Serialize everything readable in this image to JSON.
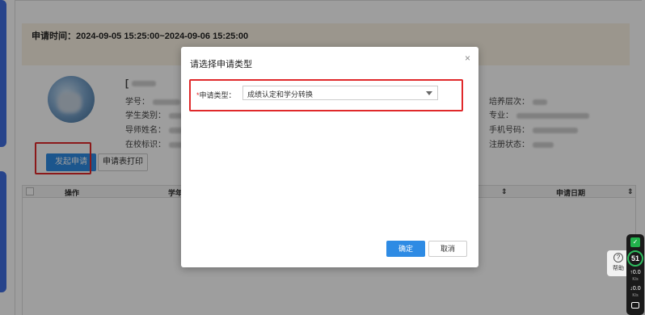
{
  "banner": {
    "apply_time": "申请时间：2024-09-05 15:25:00~2024-09-06 15:25:00"
  },
  "student": {
    "name_initial": "[",
    "fields_left": [
      "学号：",
      "学生类别：",
      "导师姓名：",
      "在校标识："
    ],
    "fields_right": [
      "培养层次：",
      "专业：",
      "手机号码：",
      "注册状态："
    ]
  },
  "actions": {
    "apply_button": "发起申请",
    "print_button": "申请表打印"
  },
  "table": {
    "col_action": "操作",
    "col_year": "学年学",
    "col_date": "申请日期"
  },
  "modal": {
    "title": "请选择申请类型",
    "close": "×",
    "field_label": "申请类型：",
    "required_mark": "*",
    "selected_value": "成绩认定和学分转换",
    "ok_button": "确定",
    "cancel_button": "取消"
  },
  "help_widget": {
    "icon": "question-icon",
    "label": "帮助"
  },
  "net_widget": {
    "gauge_value": "51",
    "up_speed": "0.0",
    "down_speed": "0.0",
    "unit": "K/s"
  },
  "colors": {
    "primary": "#2e8be4",
    "highlight": "#e0292b",
    "overlay": "rgba(0,0,0,0.38)"
  }
}
